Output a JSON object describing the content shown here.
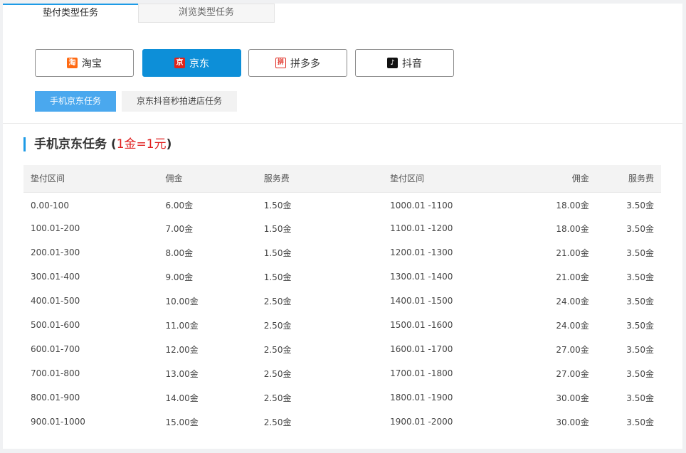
{
  "tabs": [
    {
      "label": "垫付类型任务",
      "active": true
    },
    {
      "label": "浏览类型任务",
      "active": false
    }
  ],
  "platforms": [
    {
      "label": "淘宝",
      "icon": "taobao-icon",
      "glyph": "淘",
      "active": false
    },
    {
      "label": "京东",
      "icon": "jd-icon",
      "glyph": "京",
      "active": true
    },
    {
      "label": "拼多多",
      "icon": "pinduoduo-icon",
      "glyph": "拼",
      "active": false
    },
    {
      "label": "抖音",
      "icon": "douyin-icon",
      "glyph": "♪",
      "active": false
    }
  ],
  "subtabs": [
    {
      "label": "手机京东任务",
      "active": true
    },
    {
      "label": "京东抖音秒拍进店任务",
      "active": false
    }
  ],
  "section": {
    "title": "手机京东任务",
    "rate_open": "(",
    "rate": "1金=1元",
    "rate_close": ")"
  },
  "table": {
    "headers": [
      "垫付区间",
      "佣金",
      "服务费",
      "垫付区间",
      "佣金",
      "服务费"
    ],
    "rows": [
      [
        "0.00-100",
        "6.00金",
        "1.50金",
        "1000.01 -1100",
        "18.00金",
        "3.50金"
      ],
      [
        "100.01-200",
        "7.00金",
        "1.50金",
        "1100.01 -1200",
        "18.00金",
        "3.50金"
      ],
      [
        "200.01-300",
        "8.00金",
        "1.50金",
        "1200.01 -1300",
        "21.00金",
        "3.50金"
      ],
      [
        "300.01-400",
        "9.00金",
        "1.50金",
        "1300.01 -1400",
        "21.00金",
        "3.50金"
      ],
      [
        "400.01-500",
        "10.00金",
        "2.50金",
        "1400.01 -1500",
        "24.00金",
        "3.50金"
      ],
      [
        "500.01-600",
        "11.00金",
        "2.50金",
        "1500.01 -1600",
        "24.00金",
        "3.50金"
      ],
      [
        "600.01-700",
        "12.00金",
        "2.50金",
        "1600.01 -1700",
        "27.00金",
        "3.50金"
      ],
      [
        "700.01-800",
        "13.00金",
        "2.50金",
        "1700.01 -1800",
        "27.00金",
        "3.50金"
      ],
      [
        "800.01-900",
        "14.00金",
        "2.50金",
        "1800.01 -1900",
        "30.00金",
        "3.50金"
      ],
      [
        "900.01-1000",
        "15.00金",
        "2.50金",
        "1900.01 -2000",
        "30.00金",
        "3.50金"
      ]
    ]
  },
  "colors": {
    "accent": "#1e9be6",
    "active_button": "#0d8fd8",
    "rate_red": "#e02020"
  }
}
